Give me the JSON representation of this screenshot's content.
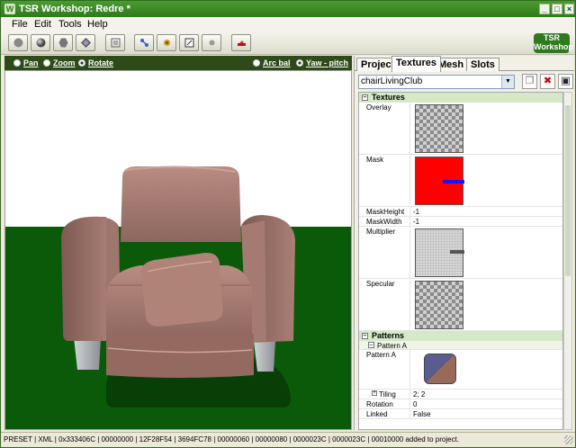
{
  "window": {
    "title": "TSR Workshop: Redre *"
  },
  "menu": [
    "File",
    "Edit",
    "Tools",
    "Help"
  ],
  "toolbar": {
    "tools": [
      "sphere-flat-icon",
      "sphere-shaded-icon",
      "hexagon-icon",
      "diamond-icon",
      "frame-icon",
      "bones-icon",
      "joints-icon",
      "texture-icon",
      "light-icon",
      "lipstick-icon"
    ]
  },
  "logo": {
    "line1": "TSR",
    "line2": "Workshop"
  },
  "viewport": {
    "modes": [
      {
        "label": "Pan",
        "selected": false
      },
      {
        "label": "Zoom",
        "selected": false
      },
      {
        "label": "Rotate",
        "selected": true
      }
    ],
    "camera": [
      {
        "label": "Arc bal",
        "selected": false
      },
      {
        "label": "Yaw - pitch",
        "selected": true
      }
    ]
  },
  "tabs": [
    "Project",
    "Textures",
    "Mesh",
    "Slots"
  ],
  "active_tab": "Textures",
  "texture_select": {
    "value": "chairLivingClub"
  },
  "properties": {
    "textures_section": "Textures",
    "overlay": "Overlay",
    "mask": "Mask",
    "mask_height_label": "MaskHeight",
    "mask_height_value": "-1",
    "mask_width_label": "MaskWidth",
    "mask_width_value": "-1",
    "multiplier": "Multiplier",
    "specular": "Specular",
    "patterns_section": "Patterns",
    "pattern_a_group": "Pattern A",
    "pattern_a": "Pattern A",
    "tiling_label": "Tiling",
    "tiling_value": "2; 2",
    "rotation_label": "Rotation",
    "rotation_value": "0",
    "linked_label": "Linked",
    "linked_value": "False"
  },
  "status": "PRESET | XML | 0x333406C | 00000000 | 12F28F54 | 3694FC78 | 00000060 | 00000080 | 0000023C | 0000023C | 00010000 added to project.",
  "colors": {
    "accent": "#2f7a1d",
    "floor": "#0b5a0a",
    "upholstery": "#a77c73"
  }
}
